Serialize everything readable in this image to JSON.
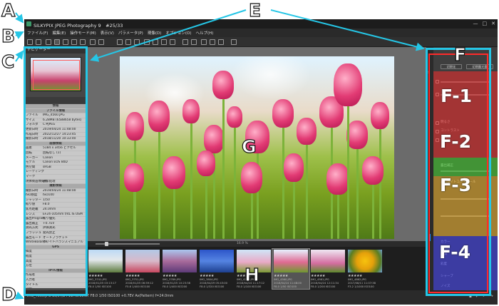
{
  "app": {
    "title": "SILKYPIX JPEG Photography 9　#25/33",
    "window_buttons": [
      "—",
      "□",
      "✕"
    ]
  },
  "menu": [
    "ファイル(F)",
    "編集(E)",
    "操作モード(M)",
    "表示(V)",
    "パラメータ(P)",
    "現像(D)",
    "オプション(O)",
    "ヘルプ(H)"
  ],
  "left_panel": {
    "nav_title": "ナビゲーター",
    "exif_rows": [
      {
        "k": "",
        "v": "情報",
        "sec": true
      },
      {
        "k": "",
        "v": "ファイル情報",
        "sec": true
      },
      {
        "k": "ファイル",
        "v": "IMG_4560.JPG"
      },
      {
        "k": "サイズ",
        "v": "6.28MB (6588658 bytes)"
      },
      {
        "k": "フォルダ",
        "v": "C:¥JPEG"
      },
      {
        "k": "更新日時",
        "v": "2019/04/24 11:48:00"
      },
      {
        "k": "作成日時",
        "v": "2022/12/27 14:23:45"
      },
      {
        "k": "撮影日時",
        "v": "2018/11/20 10:33:40"
      },
      {
        "k": "",
        "v": "画像情報",
        "sec": true
      },
      {
        "k": "画素",
        "v": "5184 x 3456 ピクセル"
      },
      {
        "k": "回転",
        "v": "回転なし (1)"
      },
      {
        "k": "メーカー",
        "v": "Canon"
      },
      {
        "k": "モデル",
        "v": "Canon EOS 80D"
      },
      {
        "k": "色空間",
        "v": "sRGB"
      },
      {
        "k": "レーティング",
        "v": ""
      },
      {
        "k": "マーク",
        "v": ""
      },
      {
        "k": "現像後画像処理",
        "v": "通常処理"
      },
      {
        "k": "",
        "v": "撮影情報",
        "sec": true
      },
      {
        "k": "撮影日時",
        "v": "2019/04/24 11:48:00"
      },
      {
        "k": "ISO感度",
        "v": "ISO100"
      },
      {
        "k": "シャッター",
        "v": "1/50"
      },
      {
        "k": "絞り値",
        "v": "F8.0"
      },
      {
        "k": "焦点距離",
        "v": "24.0mm"
      },
      {
        "k": "レンズ",
        "v": "EF24-105mm f/4L IS USM"
      },
      {
        "k": "露出Program",
        "v": "絞り優先"
      },
      {
        "k": "露出補正",
        "v": "+0.7EV"
      },
      {
        "k": "測光方式",
        "v": "評価測光"
      },
      {
        "k": "フラッシュ",
        "v": "発光禁止"
      },
      {
        "k": "露出モード",
        "v": "オートブラケット"
      },
      {
        "k": "WhiteBalance",
        "v": "ホワイトバランスマニュアル"
      },
      {
        "k": "",
        "v": "GPS",
        "sec": true
      },
      {
        "k": "緯度",
        "v": ""
      },
      {
        "k": "経度",
        "v": ""
      },
      {
        "k": "高度",
        "v": ""
      },
      {
        "k": "方位",
        "v": ""
      },
      {
        "k": "",
        "v": "IPTC情報",
        "sec": true
      },
      {
        "k": "作成者",
        "v": ""
      },
      {
        "k": "入力者",
        "v": ""
      },
      {
        "k": "タイトル",
        "v": ""
      },
      {
        "k": "説明",
        "v": ""
      },
      {
        "k": "著作権",
        "v": ""
      },
      {
        "k": "キーワード",
        "v": ""
      },
      {
        "k": "評価",
        "v": ""
      }
    ]
  },
  "viewer": {
    "zoom_label": "16.9 %"
  },
  "filmstrip": {
    "thumbs": [
      {
        "name": "IMG_3741.JPG",
        "date": "2016/01/25 03:13:17",
        "exif": "F8.0 1/50 ISO100",
        "selected": false
      },
      {
        "name": "IMG_3751.JPG",
        "date": "2016/01/25 06:59:12",
        "exif": "F5.6 1/400 ISO100",
        "selected": false
      },
      {
        "name": "IMG_3789.JPG",
        "date": "2016/01/25 10:23:38",
        "exif": "F8.0 1/400 ISO200",
        "selected": false
      },
      {
        "name": "IMG_3804.JPG",
        "date": "2016/04/29 05:43:00",
        "exif": "F8.0 1/320 ISO100",
        "selected": false
      },
      {
        "name": "IMG_4260.JPG",
        "date": "2016/04/24 11:17:12",
        "exif": "F8.0 1/100 ISO100",
        "selected": false
      },
      {
        "name": "IMG_4560.JPG",
        "date": "2016/04/24 11:48:00",
        "exif": "F8.0 1/50 ISO100",
        "selected": true
      },
      {
        "name": "IMG_4561.JPG",
        "date": "2016/04/24 12:11:34",
        "exif": "F8.0 1/200 ISO100",
        "selected": false
      },
      {
        "name": "IMG_4862.JPG",
        "date": "2017/08/11 11:07:38",
        "exif": "F3.2 1/1000 ISO100",
        "selected": false
      }
    ]
  },
  "right_panel": {
    "labels": [
      "初期化",
      "初期露光量",
      "明るさ",
      "コントラスト",
      "カラー",
      "露出補正",
      "ハイライトコントロール",
      "カラー",
      "階調",
      "彩度",
      "シャープ",
      "ノイズ"
    ]
  },
  "status": {
    "text": "IMG_4560.JPG 16/04/24 11:48:00.97  F8.0  1/50  ISO100  +0.7EV  Av(Pattern)  f=24.0mm"
  },
  "annotations": {
    "A": "A",
    "B": "B",
    "C": "C",
    "D": "D",
    "E": "E",
    "F": "F",
    "F1": "F-1",
    "F2": "F-2",
    "F3": "F-3",
    "F4": "F-4",
    "G": "G",
    "H": "H"
  }
}
